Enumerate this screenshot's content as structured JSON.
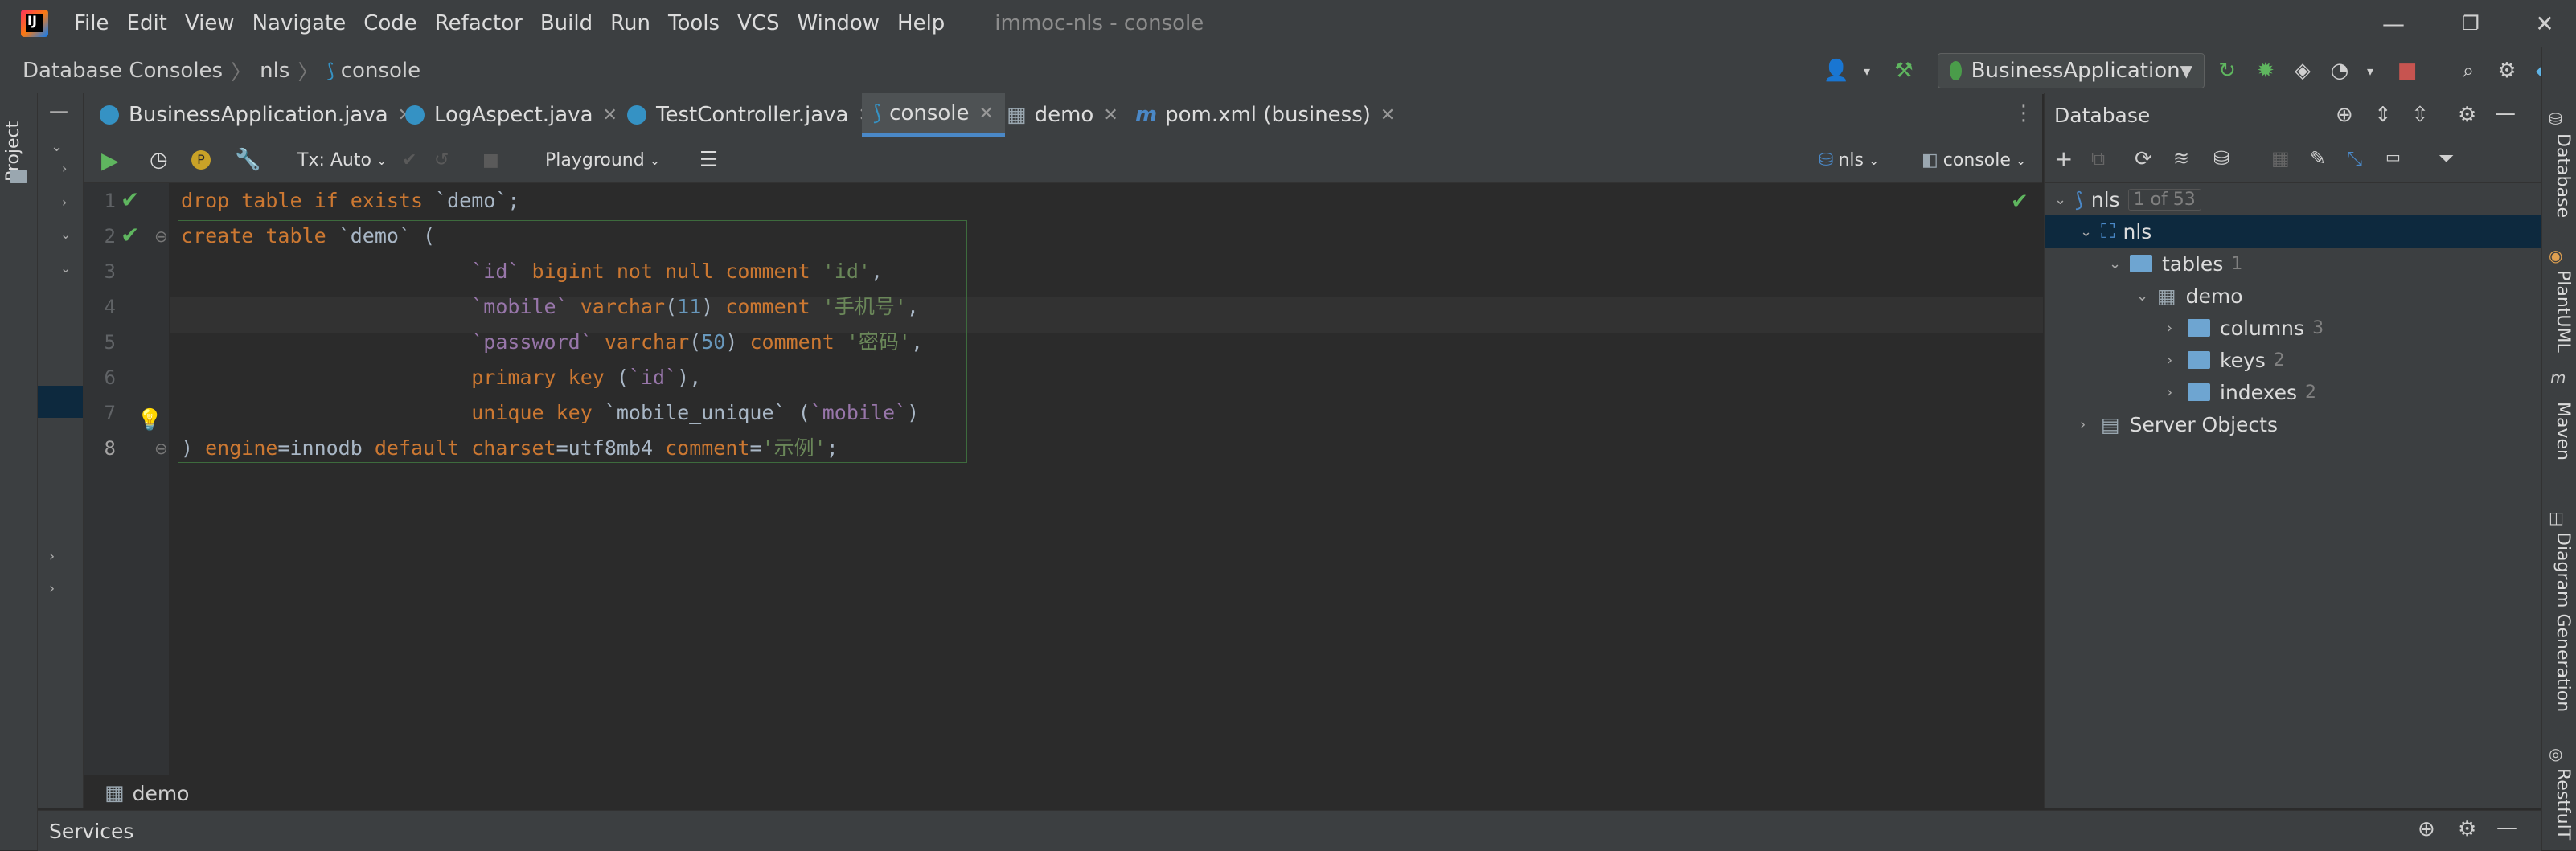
{
  "menu": {
    "items": [
      "File",
      "Edit",
      "View",
      "Navigate",
      "Code",
      "Refactor",
      "Build",
      "Run",
      "Tools",
      "VCS",
      "Window",
      "Help"
    ],
    "title": "immoc-nls - console"
  },
  "breadcrumb": [
    "Database Consoles",
    "nls",
    "console"
  ],
  "run_config": "BusinessApplication",
  "left_strip_label": "Project",
  "tabs": [
    {
      "label": "BusinessApplication.java",
      "icon_color": "#3592c4"
    },
    {
      "label": "LogAspect.java",
      "icon_color": "#3592c4"
    },
    {
      "label": "TestController.java",
      "icon_color": "#3592c4"
    },
    {
      "label": "console",
      "icon_color": "#3592c4"
    },
    {
      "label": "demo",
      "icon_color": "#9aa7b0"
    },
    {
      "label": "pom.xml (business)",
      "icon_color": "#4a88c7"
    }
  ],
  "console_toolbar": {
    "tx": "Tx: Auto",
    "playground": "Playground",
    "datasource": "nls",
    "session": "console"
  },
  "line_numbers": [
    "1",
    "2",
    "3",
    "4",
    "5",
    "6",
    "7",
    "8"
  ],
  "code_lines": [
    "drop table if exists `demo`;",
    "create table `demo` (",
    "                        `id` bigint not null comment 'id',",
    "                        `mobile` varchar(11) comment '手机号',",
    "                        `password` varchar(50) comment '密码',",
    "                        primary key (`id`),",
    "                        unique key `mobile_unique` (`mobile`)",
    ") engine=innodb default charset=utf8mb4 comment='示例';"
  ],
  "editor_status": "demo",
  "database_panel": {
    "title": "Database",
    "tree": [
      {
        "label": "nls",
        "count": "1 of 53",
        "level": 0
      },
      {
        "label": "nls",
        "count": "",
        "level": 1
      },
      {
        "label": "tables",
        "count": "1",
        "level": 2
      },
      {
        "label": "demo",
        "count": "",
        "level": 3
      },
      {
        "label": "columns",
        "count": "3",
        "level": 4
      },
      {
        "label": "keys",
        "count": "2",
        "level": 4
      },
      {
        "label": "indexes",
        "count": "2",
        "level": 4
      },
      {
        "label": "Server Objects",
        "count": "",
        "level": 1
      }
    ]
  },
  "right_strip": [
    "Database",
    "PlantUML",
    "Maven",
    "Diagram Generation",
    "RestfulT"
  ],
  "services_label": "Services",
  "colors": {
    "keyword": "#cc7832",
    "string": "#6a8759",
    "number": "#6897bb",
    "field": "#9876aa",
    "check": "#5fb65f",
    "accent": "#4a88c7"
  }
}
